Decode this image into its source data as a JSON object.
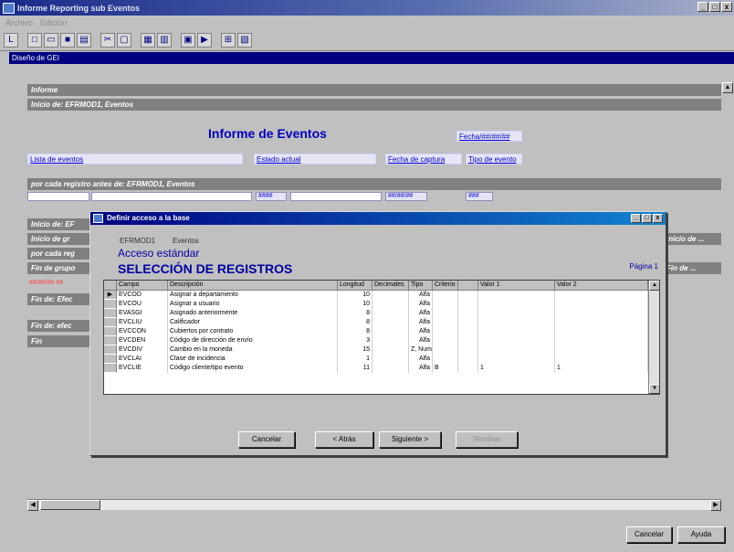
{
  "window": {
    "title": "Informe Reporting sub Eventos",
    "min": "_",
    "max": "□",
    "close": "x"
  },
  "menu": [
    "Archivo",
    "Edición"
  ],
  "document": {
    "title": "Diseño de GEI"
  },
  "report": {
    "bands": [
      "Informe",
      "Inicio de: EFRMOD1, Eventos",
      "por cada registro antes de: EFRMOD1, Eventos",
      "Inicio de: EF",
      "Inicio de gr",
      "por cada reg",
      "Fin de grupo",
      "Fin de: Efec",
      "Fin de: efec",
      "Fin"
    ],
    "title": "Informe de Eventos",
    "date_label": "Fecha/##/##/##",
    "labels": [
      "Lista de eventos",
      "Estado actual",
      "Fecha de captura",
      "Tipo de evento"
    ],
    "field_samples": [
      "####",
      "##/##/##",
      "###"
    ],
    "red_sample": "##/##/## ##",
    "right_band_text": [
      "Inicio de ...",
      "Fin de ..."
    ]
  },
  "dialog": {
    "title": "Definir acceso a la base",
    "crumb_code": "EFRMOD1",
    "crumb_name": "Eventos",
    "subtitle": "Acceso estándar",
    "heading": "SELECCIÓN DE REGISTROS",
    "page_label": "Página 1",
    "columns": [
      "Campo",
      "Descripción",
      "Longitud",
      "Decimales",
      "Tipo",
      "Criterio",
      "Valor 1",
      "",
      "Valor 2"
    ],
    "rows": [
      {
        "campo": "EVCOD",
        "desc": "Asignar a departamento",
        "long": "10",
        "dec": "",
        "tipo": "Alfa",
        "crit": "",
        "v1": "",
        "v2": "",
        "current": true
      },
      {
        "campo": "EVCOU",
        "desc": "Asignar a usuario",
        "long": "10",
        "dec": "",
        "tipo": "Alfa",
        "crit": "",
        "v1": "",
        "v2": "",
        "current": false
      },
      {
        "campo": "EVASGI",
        "desc": "Asignado anteriormente",
        "long": "8",
        "dec": "",
        "tipo": "Alfa",
        "crit": "",
        "v1": "",
        "v2": "",
        "current": false
      },
      {
        "campo": "EVCLIU",
        "desc": "Calificador",
        "long": "8",
        "dec": "",
        "tipo": "Alfa",
        "crit": "",
        "v1": "",
        "v2": "",
        "current": false
      },
      {
        "campo": "EVCCON",
        "desc": "Cubiertos por contrato",
        "long": "8",
        "dec": "",
        "tipo": "Alfa",
        "crit": "",
        "v1": "",
        "v2": "",
        "current": false
      },
      {
        "campo": "EVCDEN",
        "desc": "Código de dirección de envío",
        "long": "3",
        "dec": "",
        "tipo": "Alfa",
        "crit": "",
        "v1": "",
        "v2": "",
        "current": false
      },
      {
        "campo": "EVCDIV",
        "desc": "Cambio en la moneda",
        "long": "15",
        "dec": "",
        "tipo": "Z, Num",
        "crit": "",
        "v1": "",
        "v2": "",
        "current": false
      },
      {
        "campo": "EVCLAI",
        "desc": "Clase de incidencia",
        "long": "1",
        "dec": "",
        "tipo": "Alfa",
        "crit": "",
        "v1": "",
        "v2": "",
        "current": false
      },
      {
        "campo": "EVCLIE",
        "desc": "Código cliente/tipo evento",
        "long": "11",
        "dec": "",
        "tipo": "Alfa",
        "crit": "B",
        "v1": "1",
        "v2": "1",
        "current": false
      }
    ],
    "buttons": {
      "cancel": "Cancelar",
      "prev": "< Atrás",
      "next": "Siguiente >",
      "finish": "Terminar"
    }
  },
  "footer": {
    "cancel": "Cancelar",
    "help": "Ayuda"
  }
}
